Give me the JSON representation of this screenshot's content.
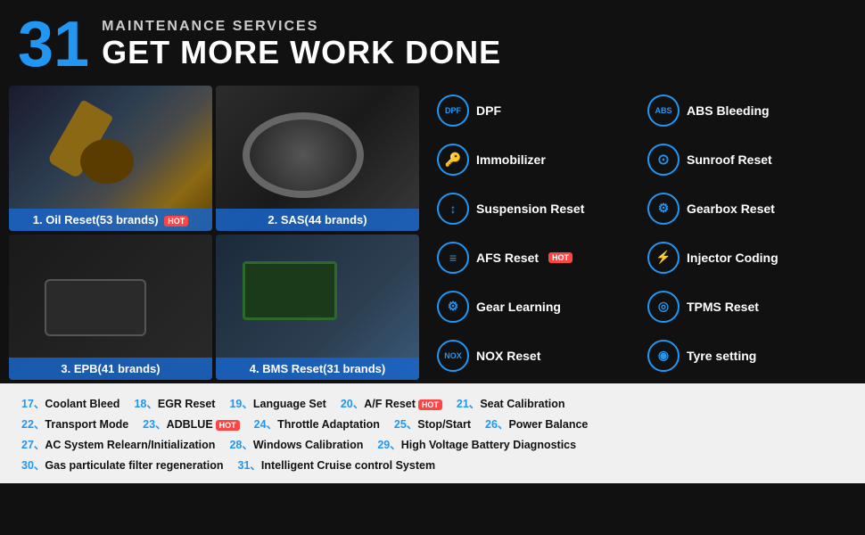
{
  "header": {
    "number": "31",
    "subtitle": "MAINTENANCE SERVICES",
    "title": "GET MORE WORK DONE"
  },
  "photos": [
    {
      "id": "oil",
      "label": "1. Oil Reset(53 brands)",
      "hot": true
    },
    {
      "id": "sas",
      "label": "2. SAS(44 brands)",
      "hot": false
    },
    {
      "id": "epb",
      "label": "3. EPB(41 brands)",
      "hot": false
    },
    {
      "id": "bms",
      "label": "4. BMS Reset(31 brands)",
      "hot": false
    }
  ],
  "services": [
    {
      "icon": "DPF",
      "name": "DPF"
    },
    {
      "icon": "ABS",
      "name": "ABS Bleeding"
    },
    {
      "icon": "🔑",
      "name": "Immobilizer"
    },
    {
      "icon": "⊙",
      "name": "Sunroof Reset"
    },
    {
      "icon": "↕",
      "name": "Suspension Reset"
    },
    {
      "icon": "⚙",
      "name": "Gearbox Reset"
    },
    {
      "icon": "≡",
      "name": "AFS Reset",
      "hot": true
    },
    {
      "icon": "⚡",
      "name": "Injector Coding"
    },
    {
      "icon": "⚙",
      "name": "Gear Learning"
    },
    {
      "icon": "◎",
      "name": "TPMS Reset"
    },
    {
      "icon": "NOX",
      "name": "NOX Reset"
    },
    {
      "icon": "◉",
      "name": "Tyre setting"
    }
  ],
  "bottom_items": [
    {
      "num": "17、",
      "name": "Coolant Bleed"
    },
    {
      "num": "18、",
      "name": "EGR Reset"
    },
    {
      "num": "19、",
      "name": "Language Set"
    },
    {
      "num": "20、",
      "name": "A/F Reset",
      "hot": true
    },
    {
      "num": "21、",
      "name": "Seat Calibration"
    },
    {
      "num": "22、",
      "name": "Transport Mode"
    },
    {
      "num": "23、",
      "name": "ADBLUE",
      "hot": true
    },
    {
      "num": "24、",
      "name": "Throttle Adaptation"
    },
    {
      "num": "25、",
      "name": "Stop/Start"
    },
    {
      "num": "26、",
      "name": "Power Balance"
    },
    {
      "num": "27、",
      "name": "AC System Relearn/Initialization"
    },
    {
      "num": "28、",
      "name": "Windows Calibration"
    },
    {
      "num": "29、",
      "name": "High Voltage Battery Diagnostics"
    },
    {
      "num": "30、",
      "name": "Gas particulate filter regeneration"
    },
    {
      "num": "31、",
      "name": "Intelligent Cruise control System"
    }
  ]
}
